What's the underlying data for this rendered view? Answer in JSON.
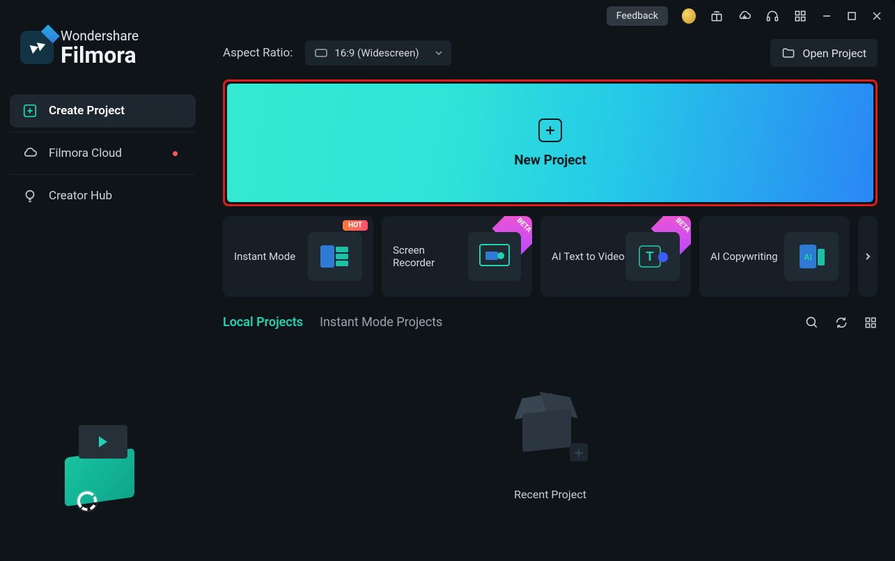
{
  "branding": {
    "company": "Wondershare",
    "product": "Filmora"
  },
  "sidebar": {
    "items": [
      {
        "label": "Create Project",
        "active": true
      },
      {
        "label": "Filmora Cloud"
      },
      {
        "label": "Creator Hub"
      }
    ]
  },
  "titlebar": {
    "feedback_label": "Feedback"
  },
  "aspect_ratio": {
    "label": "Aspect Ratio:",
    "selected": "16:9 (Widescreen)"
  },
  "open_project_label": "Open Project",
  "new_project_label": "New Project",
  "cards": [
    {
      "label": "Instant Mode",
      "badge": "HOT"
    },
    {
      "label": "Screen Recorder",
      "badge": "BETA"
    },
    {
      "label": "AI Text to Video",
      "badge": "BETA"
    },
    {
      "label": "AI Copywriting"
    }
  ],
  "tabs": {
    "local": "Local Projects",
    "instant": "Instant Mode Projects"
  },
  "empty_state_label": "Recent Project"
}
